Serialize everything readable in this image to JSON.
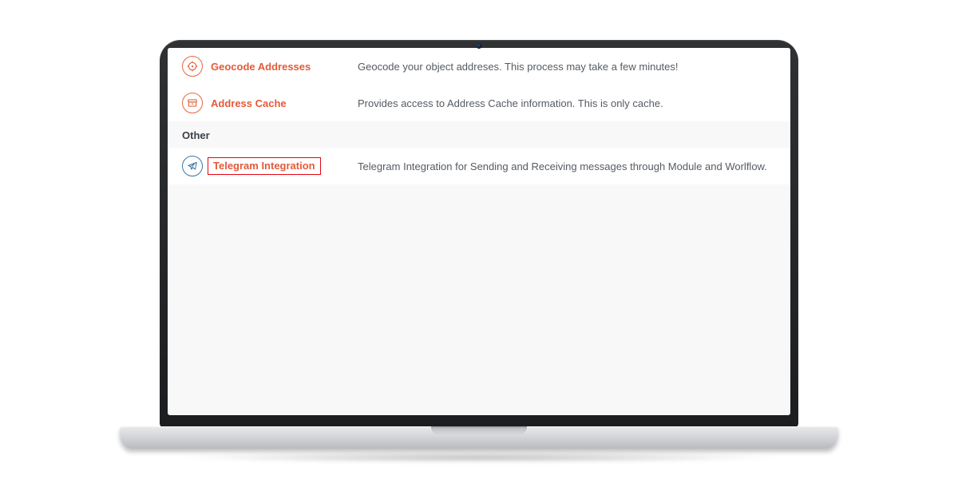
{
  "rows": [
    {
      "label": "Geocode Addresses",
      "desc": "Geocode your object addreses. This process may take a few minutes!"
    },
    {
      "label": "Address Cache",
      "desc": "Provides access to Address Cache information. This is only cache."
    }
  ],
  "section_other": "Other",
  "telegram": {
    "label": "Telegram Integration",
    "desc": "Telegram Integration for Sending and Receiving messages through Module and Worlflow."
  }
}
